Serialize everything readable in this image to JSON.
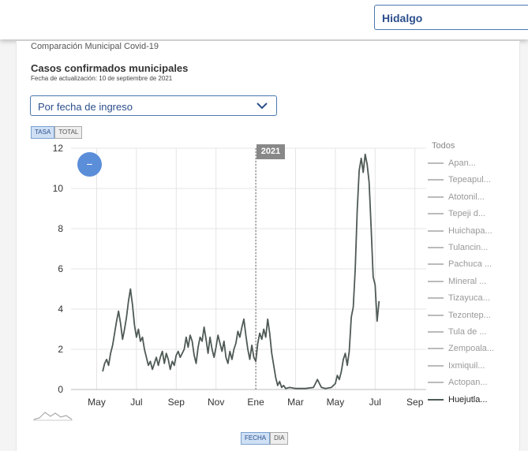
{
  "header": {
    "region_value": "Hidalgo"
  },
  "section_label": "Comparación Municipal Covid-19",
  "chart_title": "Casos confirmados municipales",
  "update_date": "Fecha de actualización: 10 de septiembre de 2021",
  "mode_select": {
    "value": "Por fecha de ingreso"
  },
  "metric_toggle": [
    {
      "label": "TASA",
      "active": true
    },
    {
      "label": "TOTAL",
      "active": false
    }
  ],
  "axis_toggle": [
    {
      "label": "FECHA",
      "active": true
    },
    {
      "label": "DIA",
      "active": false
    }
  ],
  "zoom_label": "−",
  "year_marker": "2021",
  "legend": {
    "title": "Todos",
    "items": [
      "Apan...",
      "Tepeapul...",
      "Atotonil...",
      "Tepeji d...",
      "Huichapa...",
      "Tulancin...",
      "Pachuca ...",
      "Mineral ...",
      "Tizayuca...",
      "Tezontep...",
      "Tula de ...",
      "Zempoala...",
      "Ixmiquil...",
      "Actopan...",
      "Huejutla..."
    ],
    "active_index": 14
  },
  "colors": {
    "accent": "#4a78b0",
    "line": "#4f5a55",
    "zoom": "#5b8ed9",
    "badge": "#888888"
  },
  "chart_data": {
    "type": "line",
    "x_tick_labels": [
      "May",
      "Jul",
      "Sep",
      "Nov",
      "Ene",
      "Mar",
      "May",
      "Jul",
      "Sep"
    ],
    "y_ticks": [
      0,
      2,
      4,
      6,
      8,
      10,
      12
    ],
    "ylim": [
      0,
      12
    ],
    "x_range_months": [
      3.5,
      16.1
    ],
    "year_marker_month": 12,
    "grid": true,
    "legend_position": "right",
    "series": [
      {
        "name": "Huejutla...",
        "points": [
          [
            4.3,
            0.9
          ],
          [
            4.4,
            1.3
          ],
          [
            4.5,
            1.5
          ],
          [
            4.6,
            1.2
          ],
          [
            4.7,
            1.8
          ],
          [
            4.8,
            2.2
          ],
          [
            4.9,
            2.8
          ],
          [
            5.0,
            3.4
          ],
          [
            5.1,
            3.9
          ],
          [
            5.2,
            3.3
          ],
          [
            5.3,
            2.5
          ],
          [
            5.4,
            3.0
          ],
          [
            5.5,
            3.6
          ],
          [
            5.6,
            4.4
          ],
          [
            5.7,
            5.0
          ],
          [
            5.8,
            4.2
          ],
          [
            5.9,
            3.2
          ],
          [
            6.0,
            2.6
          ],
          [
            6.1,
            3.0
          ],
          [
            6.2,
            2.4
          ],
          [
            6.3,
            2.6
          ],
          [
            6.4,
            2.0
          ],
          [
            6.5,
            1.6
          ],
          [
            6.6,
            1.2
          ],
          [
            6.7,
            1.4
          ],
          [
            6.8,
            1.0
          ],
          [
            6.9,
            1.3
          ],
          [
            7.0,
            1.6
          ],
          [
            7.1,
            1.2
          ],
          [
            7.2,
            1.6
          ],
          [
            7.3,
            1.9
          ],
          [
            7.4,
            1.3
          ],
          [
            7.5,
            1.8
          ],
          [
            7.6,
            1.5
          ],
          [
            7.7,
            1.0
          ],
          [
            7.8,
            1.4
          ],
          [
            7.9,
            1.2
          ],
          [
            8.0,
            1.7
          ],
          [
            8.1,
            1.9
          ],
          [
            8.2,
            1.6
          ],
          [
            8.3,
            1.8
          ],
          [
            8.4,
            2.0
          ],
          [
            8.5,
            2.6
          ],
          [
            8.6,
            2.1
          ],
          [
            8.7,
            2.7
          ],
          [
            8.8,
            2.4
          ],
          [
            8.9,
            1.7
          ],
          [
            9.0,
            1.3
          ],
          [
            9.1,
            2.1
          ],
          [
            9.2,
            2.6
          ],
          [
            9.3,
            2.4
          ],
          [
            9.4,
            3.1
          ],
          [
            9.5,
            2.5
          ],
          [
            9.6,
            1.8
          ],
          [
            9.7,
            2.6
          ],
          [
            9.8,
            2.0
          ],
          [
            9.9,
            1.6
          ],
          [
            10.0,
            2.1
          ],
          [
            10.1,
            2.7
          ],
          [
            10.2,
            2.3
          ],
          [
            10.3,
            1.9
          ],
          [
            10.4,
            2.4
          ],
          [
            10.5,
            1.6
          ],
          [
            10.6,
            1.3
          ],
          [
            10.7,
            1.9
          ],
          [
            10.8,
            1.5
          ],
          [
            10.9,
            2.0
          ],
          [
            11.0,
            2.3
          ],
          [
            11.1,
            2.9
          ],
          [
            11.2,
            2.6
          ],
          [
            11.3,
            3.1
          ],
          [
            11.4,
            3.5
          ],
          [
            11.5,
            2.7
          ],
          [
            11.6,
            2.0
          ],
          [
            11.7,
            1.5
          ],
          [
            11.8,
            2.2
          ],
          [
            11.9,
            1.6
          ],
          [
            12.0,
            1.4
          ],
          [
            12.1,
            2.3
          ],
          [
            12.2,
            2.8
          ],
          [
            12.3,
            2.5
          ],
          [
            12.4,
            3.0
          ],
          [
            12.5,
            2.6
          ],
          [
            12.6,
            3.5
          ],
          [
            12.7,
            2.8
          ],
          [
            12.8,
            1.8
          ],
          [
            12.9,
            1.2
          ],
          [
            13.0,
            0.6
          ],
          [
            13.1,
            0.2
          ],
          [
            13.2,
            0.4
          ],
          [
            13.3,
            0.1
          ],
          [
            13.4,
            0.2
          ],
          [
            13.5,
            0.05
          ],
          [
            13.7,
            0.1
          ],
          [
            14.0,
            0.05
          ],
          [
            14.5,
            0.05
          ],
          [
            14.9,
            0.1
          ],
          [
            15.0,
            0.3
          ],
          [
            15.1,
            0.5
          ],
          [
            15.2,
            0.3
          ],
          [
            15.3,
            0.1
          ],
          [
            15.5,
            0.05
          ],
          [
            15.8,
            0.1
          ],
          [
            16.0,
            0.3
          ],
          [
            16.1,
            0.7
          ],
          [
            16.2,
            0.5
          ],
          [
            16.3,
            0.9
          ],
          [
            16.4,
            1.5
          ],
          [
            16.5,
            1.8
          ],
          [
            16.6,
            1.2
          ],
          [
            16.7,
            1.9
          ],
          [
            16.8,
            3.6
          ],
          [
            16.9,
            4.1
          ],
          [
            17.0,
            6.0
          ],
          [
            17.1,
            8.9
          ],
          [
            17.2,
            10.9
          ],
          [
            17.3,
            11.5
          ],
          [
            17.4,
            10.8
          ],
          [
            17.5,
            11.7
          ],
          [
            17.6,
            11.2
          ],
          [
            17.7,
            10.3
          ],
          [
            17.8,
            8.0
          ],
          [
            17.9,
            5.6
          ],
          [
            18.0,
            5.2
          ],
          [
            18.1,
            3.4
          ],
          [
            18.2,
            4.4
          ]
        ]
      }
    ]
  }
}
